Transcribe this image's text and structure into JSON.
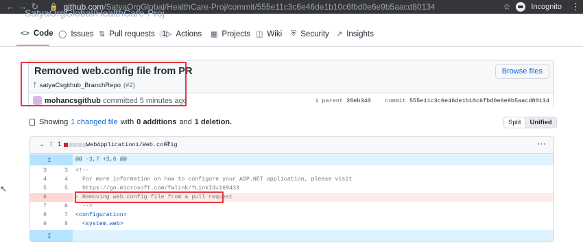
{
  "browser": {
    "url_host": "github.com",
    "url_path": "/SatyaOrgGlobal/HealthCare-Proj/commit/555e11c3c6e46de1b10c6fbd0e6e9b5aacd80134",
    "profile_label": "Incognito"
  },
  "repo": {
    "name_peek": "SatyaOrgGlobal/HealthCare-Proj",
    "tabs": [
      {
        "label": "Code",
        "icon": "code-icon"
      },
      {
        "label": "Issues",
        "icon": "issue-icon"
      },
      {
        "label": "Pull requests",
        "icon": "pull-request-icon",
        "count": "1"
      },
      {
        "label": "Actions",
        "icon": "play-icon"
      },
      {
        "label": "Projects",
        "icon": "table-icon"
      },
      {
        "label": "Wiki",
        "icon": "book-icon"
      },
      {
        "label": "Security",
        "icon": "shield-icon"
      },
      {
        "label": "Insights",
        "icon": "graph-icon"
      }
    ]
  },
  "commit": {
    "title": "Removed web.config file from PR",
    "branch": "satyaCsgithub_BranchRepo",
    "pr_ref": "(#2)",
    "browse_label": "Browse files",
    "author": "mohancsgithub",
    "committed_text": "committed 5 minutes ago",
    "parent_label": "1 parent",
    "parent_sha": "20eb340",
    "commit_label": "commit",
    "commit_sha": "555e11c3c6e46de1b10c6fbd0e6e9b5aacd80134"
  },
  "summary": {
    "prefix": "Showing",
    "changed_files": "1 changed file",
    "with": "with",
    "additions": "0 additions",
    "and": "and",
    "deletions": "1 deletion.",
    "split_label": "Split",
    "unified_label": "Unified"
  },
  "file": {
    "change_count": "1",
    "path": "WebApplication1/Web.config",
    "hunk_header": "@@ -3,7 +3,6 @@",
    "lines": [
      {
        "old": "3",
        "new": "3",
        "text": "<!--",
        "type": "context"
      },
      {
        "old": "4",
        "new": "4",
        "text": "  For more information on how to configure your ASP.NET application, please visit",
        "type": "context"
      },
      {
        "old": "5",
        "new": "5",
        "text": "  https://go.microsoft.com/fwlink/?LinkId=169433",
        "type": "context"
      },
      {
        "old": "6",
        "new": "",
        "text": "  Removing web.config file from a pull request",
        "type": "deleted"
      },
      {
        "old": "7",
        "new": "6",
        "text": "  -->",
        "type": "context"
      },
      {
        "old": "8",
        "new": "7",
        "text": "<configuration>",
        "type": "context"
      },
      {
        "old": "9",
        "new": "8",
        "text": "  <system.web>",
        "type": "context"
      }
    ]
  },
  "colors": {
    "annotation": "#e5373e",
    "link": "#0969da",
    "deleted_bg": "#ffebe9",
    "hunk_bg": "#ddf4ff"
  }
}
